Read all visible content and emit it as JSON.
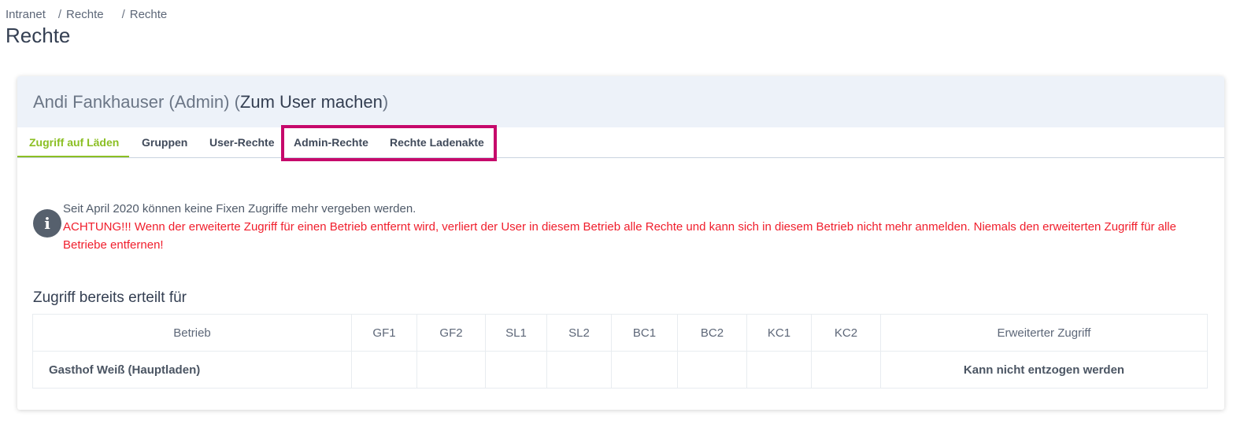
{
  "breadcrumb": {
    "items": [
      "Intranet",
      "Rechte",
      "Rechte"
    ],
    "separator": "/"
  },
  "page_title": "Rechte",
  "card": {
    "user_name": "Andi Fankhauser (Admin)",
    "open_paren": "(",
    "make_user_link": "Zum User machen",
    "close_paren": ")"
  },
  "tabs": [
    {
      "label": "Zugriff auf Läden",
      "active": true
    },
    {
      "label": "Gruppen",
      "active": false
    },
    {
      "label": "User-Rechte",
      "active": false
    },
    {
      "label": "Admin-Rechte",
      "active": false
    },
    {
      "label": "Rechte Ladenakte",
      "active": false
    }
  ],
  "info": {
    "icon": "info-icon",
    "line1": "Seit April 2020 können keine Fixen Zugriffe mehr vergeben werden.",
    "line2": "ACHTUNG!!! Wenn der erweiterte Zugriff für einen Betrieb entfernt wird, verliert der User in diesem Betrieb alle Rechte und kann sich in diesem Betrieb nicht mehr anmelden. Niemals den erweiterten Zugriff für alle Betriebe entfernen!"
  },
  "section_title": "Zugriff bereits erteilt für",
  "table": {
    "headers": [
      "Betrieb",
      "GF1",
      "GF2",
      "SL1",
      "SL2",
      "BC1",
      "BC2",
      "KC1",
      "KC2",
      "Erweiterter Zugriff"
    ],
    "rows": [
      [
        "Gasthof Weiß (Hauptladen)",
        "",
        "",
        "",
        "",
        "",
        "",
        "",
        "",
        "Kann nicht entzogen werden"
      ]
    ]
  },
  "colors": {
    "active_tab": "#8bbf23",
    "warning_text": "#f01e2c",
    "highlight_border": "#c6096b",
    "header_bg": "#edf2f9"
  }
}
